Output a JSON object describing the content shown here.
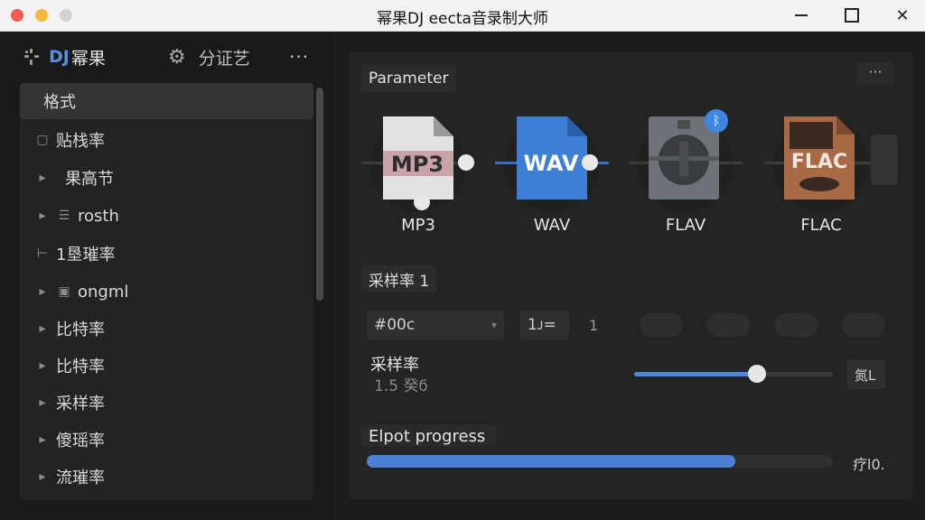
{
  "window": {
    "title": "幂果DJ eecta音录制大师"
  },
  "sidebar": {
    "tabs": [
      {
        "prefix": "DJ",
        "label": "幂果"
      },
      {
        "label": "分证艺"
      }
    ],
    "more": "···",
    "items": [
      {
        "label": "格式",
        "icon": ""
      },
      {
        "label": "贴栈率",
        "icon": "file-icon"
      },
      {
        "label": "果高节",
        "icon": ""
      },
      {
        "label": "rosth",
        "icon": "list-icon"
      },
      {
        "label": "1垦​璀率",
        "icon": ""
      },
      {
        "label": "ongml",
        "icon": "device-icon"
      },
      {
        "label": "比特率",
        "icon": ""
      },
      {
        "label": "比特率",
        "icon": ""
      },
      {
        "label": "采样率",
        "icon": ""
      },
      {
        "label": "傻瑶率",
        "icon": ""
      },
      {
        "label": "流璀率",
        "icon": ""
      }
    ]
  },
  "main": {
    "parameter_label": "Parameter",
    "more": "···",
    "formats": [
      {
        "label": "MP3",
        "badge": "MP3"
      },
      {
        "label": "WAV",
        "badge": "WAV"
      },
      {
        "label": "FLAV",
        "badge": ""
      },
      {
        "label": "FLAC",
        "badge": "FLAC"
      }
    ],
    "sample_rate_section": "采样率 1",
    "color_field": "#00ϲ",
    "small_field": "1ᴊ=",
    "small_num": "1",
    "sample_rate_label": "采样率",
    "sample_rate_value": "1.5 癸ϭ",
    "slider_value": 0.62,
    "slider_side": "氮L",
    "progress_label": "Elpot progress",
    "progress_value": 0.79,
    "progress_side": "疗l0."
  },
  "colors": {
    "accent": "#4b80d2",
    "wav": "#3d7fd6",
    "flac": "#a86a45"
  }
}
